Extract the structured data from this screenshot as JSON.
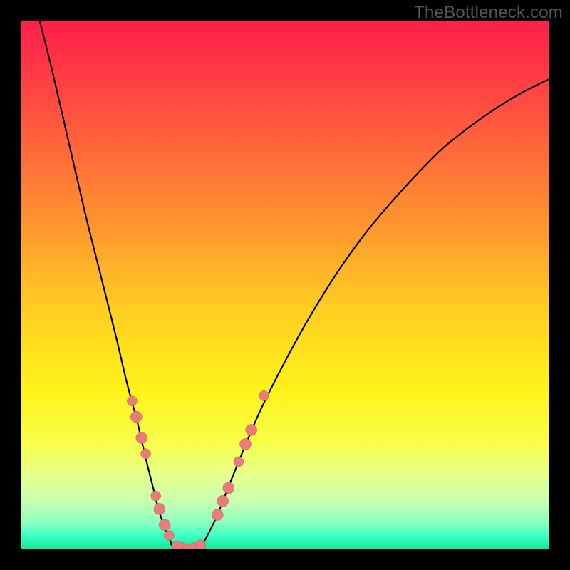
{
  "watermark": "TheBottleneck.com",
  "colors": {
    "frame_bg": "#000000",
    "curve": "#000000",
    "curve_width": 2.2,
    "marker_fill": "#e97b7b",
    "marker_stroke": "#c35a5a",
    "gradient_stops": [
      {
        "offset": 0.0,
        "color": "#ff1f4a"
      },
      {
        "offset": 0.1,
        "color": "#ff3b45"
      },
      {
        "offset": 0.25,
        "color": "#ff6a3a"
      },
      {
        "offset": 0.4,
        "color": "#ff9a2e"
      },
      {
        "offset": 0.55,
        "color": "#ffcf22"
      },
      {
        "offset": 0.7,
        "color": "#fff31a"
      },
      {
        "offset": 0.8,
        "color": "#f7fe4a"
      },
      {
        "offset": 0.86,
        "color": "#e6ff8a"
      },
      {
        "offset": 0.91,
        "color": "#c7ffb0"
      },
      {
        "offset": 0.95,
        "color": "#8effc0"
      },
      {
        "offset": 0.975,
        "color": "#3effc7"
      },
      {
        "offset": 1.0,
        "color": "#19e696"
      }
    ]
  },
  "chart_data": {
    "type": "line",
    "title": "",
    "xlabel": "",
    "ylabel": "",
    "xlim": [
      0,
      1
    ],
    "ylim": [
      0,
      1
    ],
    "series": [
      {
        "name": "left-branch",
        "x": [
          0.035,
          0.06,
          0.09,
          0.12,
          0.15,
          0.18,
          0.2,
          0.22,
          0.235,
          0.25,
          0.26,
          0.27,
          0.28,
          0.285
        ],
        "y": [
          1.0,
          0.9,
          0.77,
          0.64,
          0.52,
          0.4,
          0.315,
          0.24,
          0.175,
          0.115,
          0.075,
          0.045,
          0.02,
          0.008
        ]
      },
      {
        "name": "valley",
        "x": [
          0.285,
          0.3,
          0.315,
          0.33,
          0.345
        ],
        "y": [
          0.008,
          0.002,
          0.0,
          0.002,
          0.01
        ]
      },
      {
        "name": "right-branch",
        "x": [
          0.345,
          0.37,
          0.4,
          0.45,
          0.5,
          0.55,
          0.6,
          0.65,
          0.7,
          0.75,
          0.8,
          0.85,
          0.9,
          0.95,
          1.0
        ],
        "y": [
          0.01,
          0.06,
          0.135,
          0.255,
          0.355,
          0.445,
          0.525,
          0.595,
          0.655,
          0.71,
          0.76,
          0.8,
          0.835,
          0.865,
          0.89
        ]
      }
    ],
    "markers": [
      {
        "x": 0.21,
        "y": 0.28,
        "r": 7
      },
      {
        "x": 0.218,
        "y": 0.25,
        "r": 8
      },
      {
        "x": 0.228,
        "y": 0.21,
        "r": 8
      },
      {
        "x": 0.236,
        "y": 0.18,
        "r": 7
      },
      {
        "x": 0.255,
        "y": 0.1,
        "r": 7
      },
      {
        "x": 0.262,
        "y": 0.075,
        "r": 8
      },
      {
        "x": 0.272,
        "y": 0.045,
        "r": 8
      },
      {
        "x": 0.28,
        "y": 0.025,
        "r": 7
      },
      {
        "x": 0.295,
        "y": 0.005,
        "r": 7
      },
      {
        "x": 0.305,
        "y": 0.002,
        "r": 7
      },
      {
        "x": 0.315,
        "y": 0.0,
        "r": 7
      },
      {
        "x": 0.328,
        "y": 0.002,
        "r": 7
      },
      {
        "x": 0.34,
        "y": 0.007,
        "r": 7
      },
      {
        "x": 0.372,
        "y": 0.064,
        "r": 8
      },
      {
        "x": 0.382,
        "y": 0.09,
        "r": 8
      },
      {
        "x": 0.393,
        "y": 0.115,
        "r": 8
      },
      {
        "x": 0.412,
        "y": 0.165,
        "r": 7
      },
      {
        "x": 0.425,
        "y": 0.198,
        "r": 8
      },
      {
        "x": 0.436,
        "y": 0.225,
        "r": 8
      },
      {
        "x": 0.46,
        "y": 0.29,
        "r": 7
      }
    ]
  }
}
